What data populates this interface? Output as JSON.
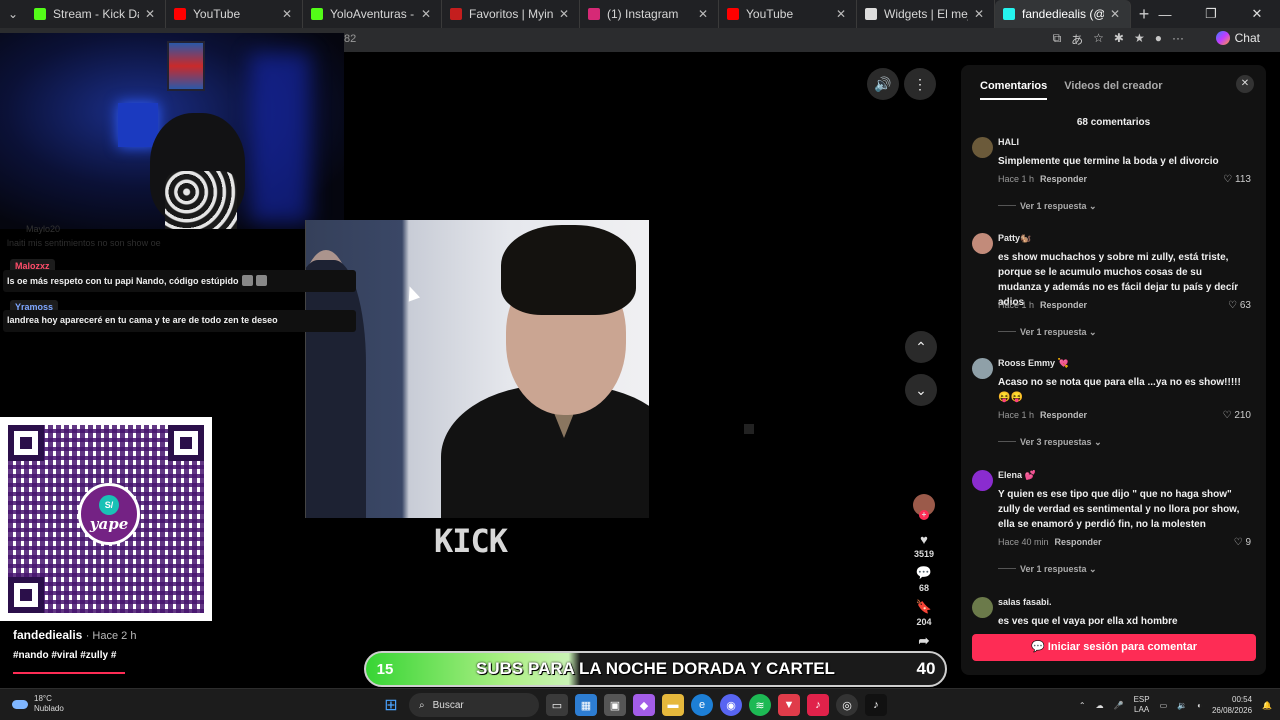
{
  "browser": {
    "tabs": [
      {
        "label": "Stream - Kick Dashboard",
        "color": "#53fc18",
        "width": 140
      },
      {
        "label": "YouTube",
        "color": "#ff0000",
        "width": 137
      },
      {
        "label": "YoloAventuras - Watch the",
        "color": "#53fc18",
        "width": 139
      },
      {
        "label": "Favoritos | Myinstants",
        "color": "#c41e1e",
        "width": 138
      },
      {
        "label": "(1) Instagram",
        "color": "#d62976",
        "width": 139
      },
      {
        "label": "YouTube",
        "color": "#ff0000",
        "width": 138
      },
      {
        "label": "Widgets | El mejor software",
        "color": "#dddddd",
        "width": 138
      },
      {
        "label": "fandediealis (@fandedie",
        "color": "#25f4ee",
        "width": 136,
        "active": true
      }
    ],
    "address_fragment": "82",
    "chat_label": "Chat"
  },
  "stream_chat": {
    "ghost_user": "Maylo20",
    "ghost_message": "lnaiti mis sentimientos no son show oe",
    "messages": [
      {
        "user": "Malozxz",
        "user_color": "#ff4d6a",
        "text": "Is oe más respeto con tu papi Nando, código estúpido"
      },
      {
        "user": "Yramoss",
        "user_color": "#7ea6ff",
        "text": "landrea hoy apareceré en tu cama y te are de todo zen te deseo"
      }
    ]
  },
  "video": {
    "watermark": "KICK",
    "likes": "3519",
    "comments": "68",
    "saves": "204",
    "shares": "46"
  },
  "caption": {
    "username": "fandediealis",
    "time": "· Hace 2 h",
    "hashtags": "#nando #viral #zully #",
    "progress": 0.12
  },
  "qr": {
    "brand": "yape",
    "badge": "S/"
  },
  "subs_banner": {
    "current": "15",
    "text": "SUBS PARA LA NOCHE DORADA Y CARTEL",
    "goal": "40"
  },
  "comments_panel": {
    "tab_comments": "Comentarios",
    "tab_creator": "Videos del creador",
    "count_label": "68 comentarios",
    "reply_label": "Responder",
    "login_label": "Iniciar sesión para comentar",
    "comments": [
      {
        "user": "HALI",
        "avatar": "#6b5a3a",
        "text": "Simplemente que termine la boda y el divorcio",
        "time": "Hace 1 h",
        "likes": "113",
        "replies": "Ver 1 respuesta"
      },
      {
        "user": "Patty🐿️",
        "avatar": "#c28b7a",
        "text": "es show muchachos y sobre mi zully, está triste, porque se le acumulo muchos cosas de su mudanza y además no es fácil dejar tu país y decír adios",
        "time": "Hace 1 h",
        "likes": "63",
        "replies": "Ver 1 respuesta"
      },
      {
        "user": "Rooss Emmy 💘",
        "avatar": "#8fa0a8",
        "text": "Acaso no se nota que para ella ...ya no es show!!!!! 😝😝",
        "time": "Hace 1 h",
        "likes": "210",
        "replies": "Ver 3 respuestas"
      },
      {
        "user": "Elena 💕",
        "avatar": "#8a2ccf",
        "text": "Y quien es ese tipo que dijo \" que no haga show\" zully de verdad es sentimental y no llora por show, ella se enamoró y perdió fin, no la molesten",
        "time": "Hace 40 min",
        "likes": "9",
        "replies": "Ver 1 respuesta"
      },
      {
        "user": "salas fasabi.",
        "avatar": "#6b7a4a",
        "text": "es ves que el vaya por ella xd hombre",
        "time": "",
        "likes": "",
        "replies": ""
      }
    ]
  },
  "taskbar": {
    "temp": "18°C",
    "weather": "Nublado",
    "search": "Buscar",
    "lang1": "ESP",
    "lang2": "LAA",
    "time": "00:54",
    "date": "26/08/2026"
  }
}
